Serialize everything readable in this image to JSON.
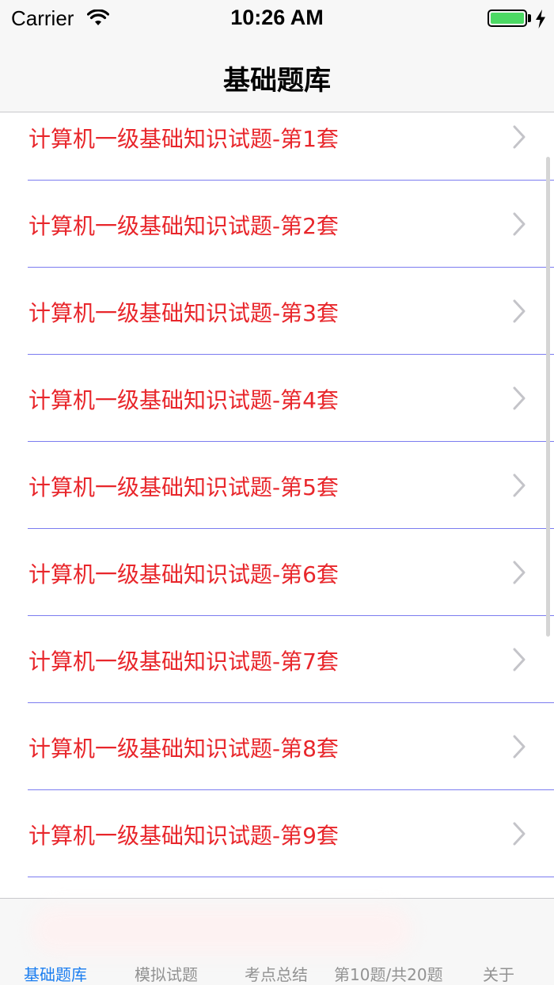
{
  "status_bar": {
    "carrier": "Carrier",
    "time": "10:26 AM",
    "battery_level": 1.0,
    "battery_color": "#4cd964",
    "icons": [
      "wifi-icon",
      "battery-icon",
      "charging-bolt-icon"
    ]
  },
  "nav": {
    "title": "基础题库"
  },
  "list": {
    "label_color": "#e8262b",
    "separator_color": "#7b7cf0",
    "disclosure_icon": "chevron-right-icon",
    "items": [
      {
        "label": "计算机一级基础知识试题-第1套"
      },
      {
        "label": "计算机一级基础知识试题-第2套"
      },
      {
        "label": "计算机一级基础知识试题-第3套"
      },
      {
        "label": "计算机一级基础知识试题-第4套"
      },
      {
        "label": "计算机一级基础知识试题-第5套"
      },
      {
        "label": "计算机一级基础知识试题-第6套"
      },
      {
        "label": "计算机一级基础知识试题-第7套"
      },
      {
        "label": "计算机一级基础知识试题-第8套"
      },
      {
        "label": "计算机一级基础知识试题-第9套"
      }
    ]
  },
  "tab_bar": {
    "active_color": "#1a7df0",
    "inactive_color": "#929292",
    "tabs": [
      {
        "label": "基础题库",
        "active": true
      },
      {
        "label": "模拟试题",
        "active": false
      },
      {
        "label": "考点总结",
        "active": false
      },
      {
        "label": "第10题/共20题",
        "active": false
      },
      {
        "label": "关于",
        "active": false
      }
    ]
  }
}
